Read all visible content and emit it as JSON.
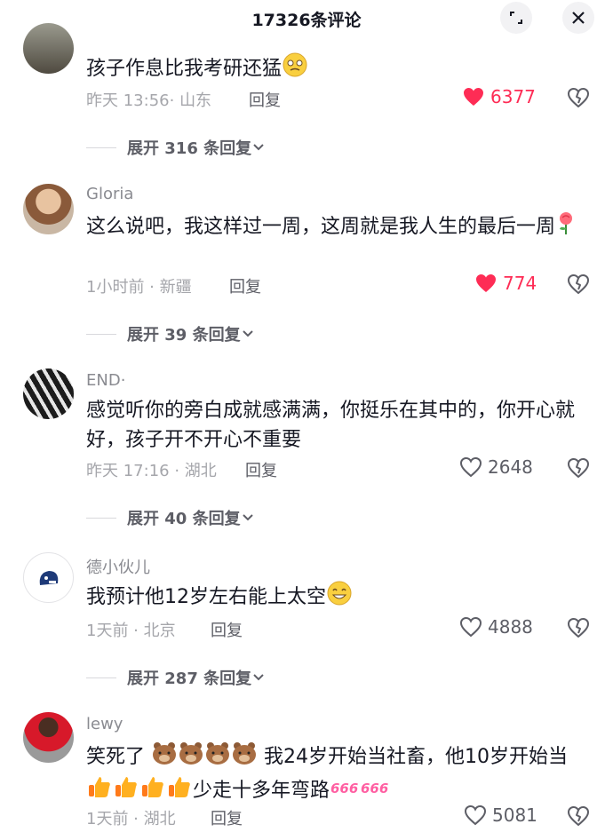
{
  "header": {
    "title": "17326条评论"
  },
  "comments": [
    {
      "username": "",
      "text": "孩子作息比我考研还猛",
      "time": "昨天 13:56",
      "location": "山东",
      "reply": "回复",
      "likes": "6377",
      "liked": true,
      "expand": "展开 316 条回复"
    },
    {
      "username": "Gloria",
      "text": "这么说吧，我这样过一周，这周就是我人生的最后一周",
      "time": "1小时前",
      "location": "新疆",
      "reply": "回复",
      "likes": "774",
      "liked": true,
      "expand": "展开 39 条回复"
    },
    {
      "username": "END·",
      "text": "感觉听你的旁白成就感满满，你挺乐在其中的，你开心就好，孩子开不开心不重要",
      "time": "昨天 17:16",
      "location": "湖北",
      "reply": "回复",
      "likes": "2648",
      "liked": false,
      "expand": "展开 40 条回复"
    },
    {
      "username": "德小伙儿",
      "text": "我预计他12岁左右能上太空",
      "time": "1天前",
      "location": "北京",
      "reply": "回复",
      "likes": "4888",
      "liked": false,
      "expand": "展开 287 条回复"
    },
    {
      "username": "lewy",
      "text_a": "笑死了",
      "text_b": "我24岁开始当社畜，他10岁开始当",
      "text_c": "少走十多年弯路",
      "time": "1天前",
      "location": "湖北",
      "reply": "回复",
      "likes": "5081",
      "liked": false
    }
  ],
  "colors": {
    "liked": "#fe2c55",
    "meta": "#a5a6ab",
    "text": "#161823"
  }
}
